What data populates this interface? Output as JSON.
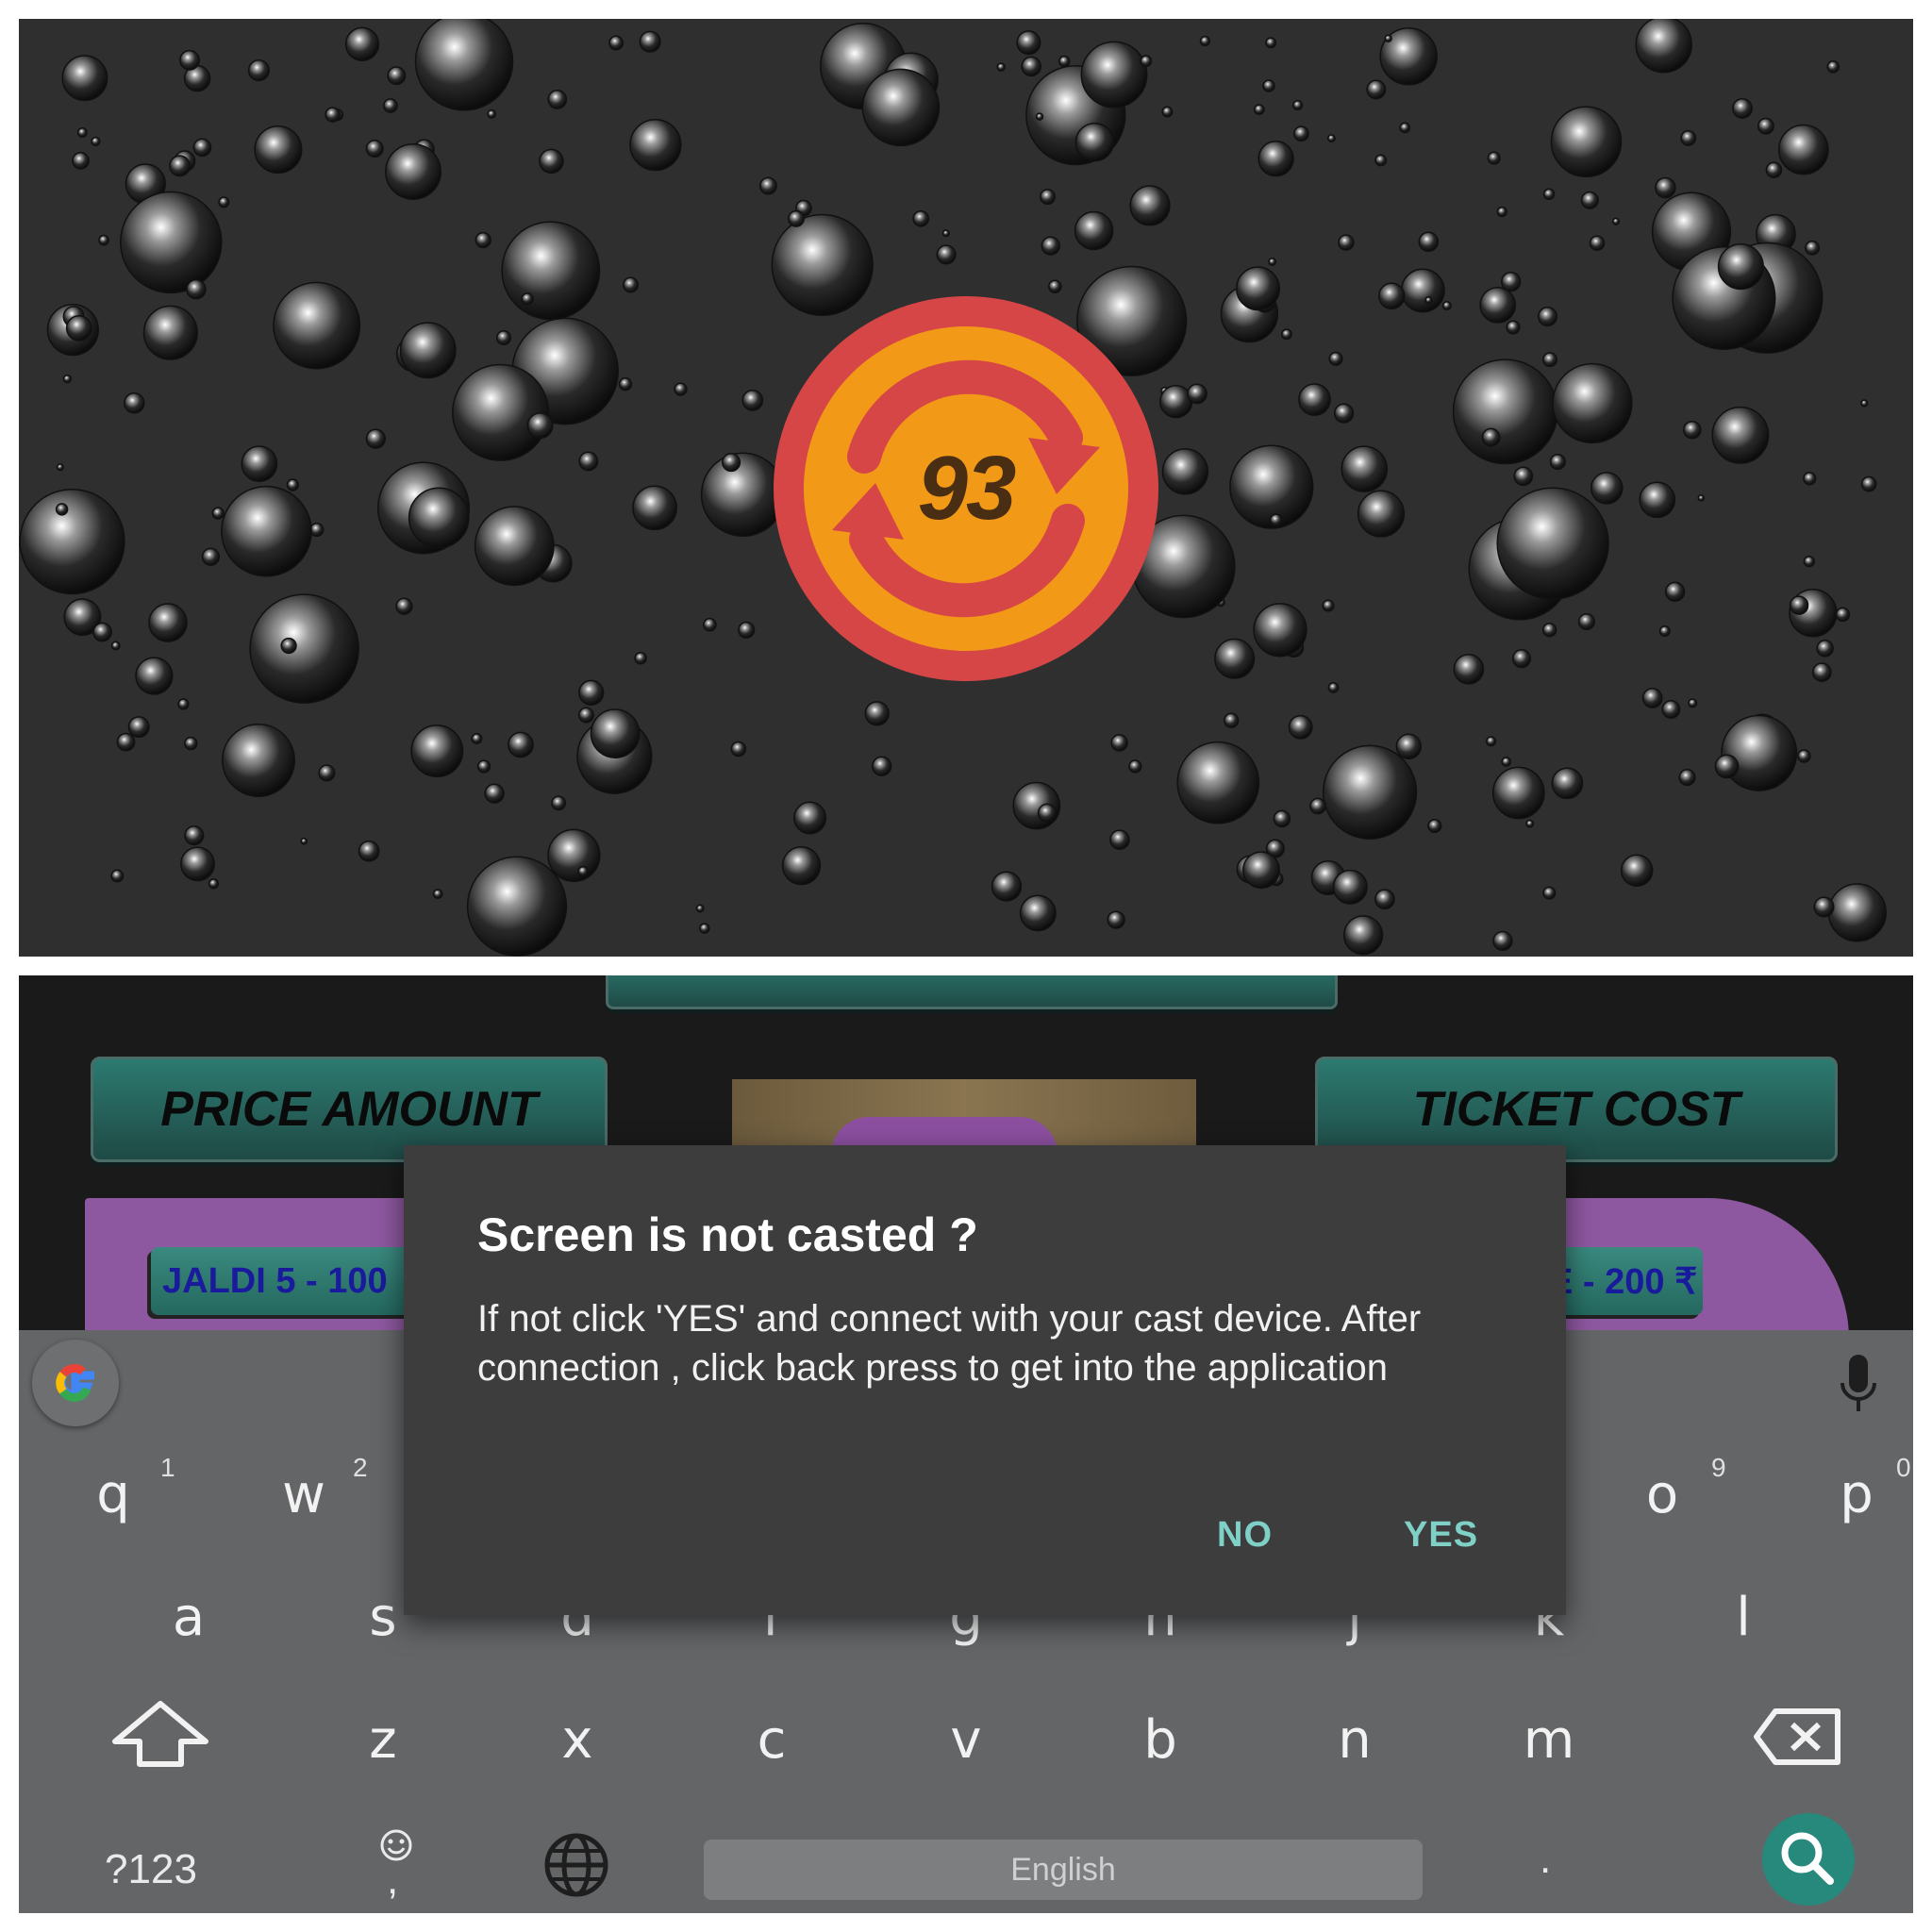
{
  "top": {
    "ball_number": "93"
  },
  "game": {
    "price_amount_label": "PRICE AMOUNT",
    "ticket_cost_label": "TICKET COST",
    "chip_left_text": "JALDI 5 - 100",
    "chip_right_text": "E - 200 ₹"
  },
  "dialog": {
    "title": "Screen is not casted ?",
    "message": "If not click 'YES' and connect with your cast device. After connection , click back press to get into the application",
    "no_label": "NO",
    "yes_label": "YES",
    "accent_color": "#7fd0c6"
  },
  "keyboard": {
    "row1": [
      {
        "key": "q",
        "hint": "1"
      },
      {
        "key": "w",
        "hint": "2"
      },
      {
        "key": "o",
        "hint": "9"
      },
      {
        "key": "p",
        "hint": "0"
      }
    ],
    "row2": [
      "a",
      "s",
      "d",
      "f",
      "g",
      "h",
      "j",
      "k",
      "l"
    ],
    "row3": [
      "z",
      "x",
      "c",
      "v",
      "b",
      "n",
      "m"
    ],
    "symbols_label": "?123",
    "space_label": "English",
    "period_label": ".",
    "comma_label": ","
  }
}
